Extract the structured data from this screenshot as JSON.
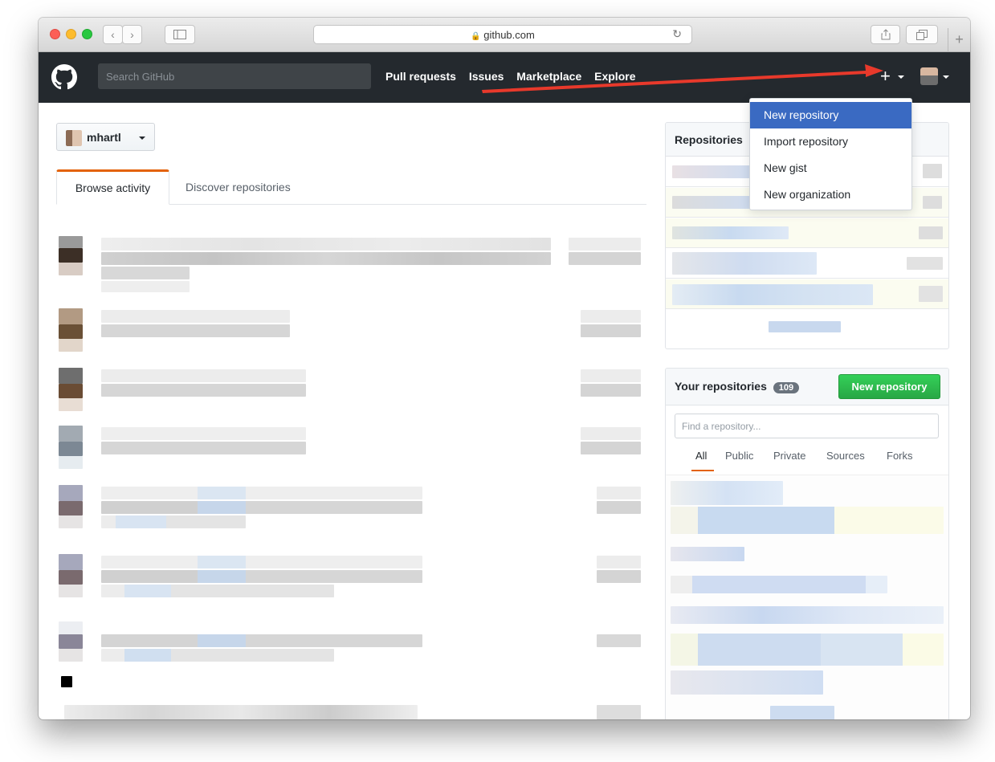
{
  "browser": {
    "url": "github.com",
    "reload_glyph": "↻",
    "newtab_glyph": "+"
  },
  "header": {
    "search_placeholder": "Search GitHub",
    "nav": [
      "Pull requests",
      "Issues",
      "Marketplace",
      "Explore"
    ],
    "plus_glyph": "+"
  },
  "dropdown": {
    "items": [
      "New repository",
      "Import repository",
      "New gist",
      "New organization"
    ],
    "active_index": 0
  },
  "context": {
    "username": "mhartl"
  },
  "tabs": [
    "Browse activity",
    "Discover repositories"
  ],
  "sidebar": {
    "repositories_title": "Repositories",
    "your_repositories_title": "Your repositories",
    "repo_count": "109",
    "new_repo_button": "New repository",
    "find_placeholder": "Find a repository...",
    "filters": [
      "All",
      "Public",
      "Private",
      "Sources",
      "Forks"
    ],
    "active_filter": "All"
  },
  "colors": {
    "header_bg": "#24292e",
    "accent_orange": "#e36209",
    "dropdown_active": "#3a6ac2",
    "green_button": "#28a745",
    "annotation_arrow": "#e8392b"
  }
}
